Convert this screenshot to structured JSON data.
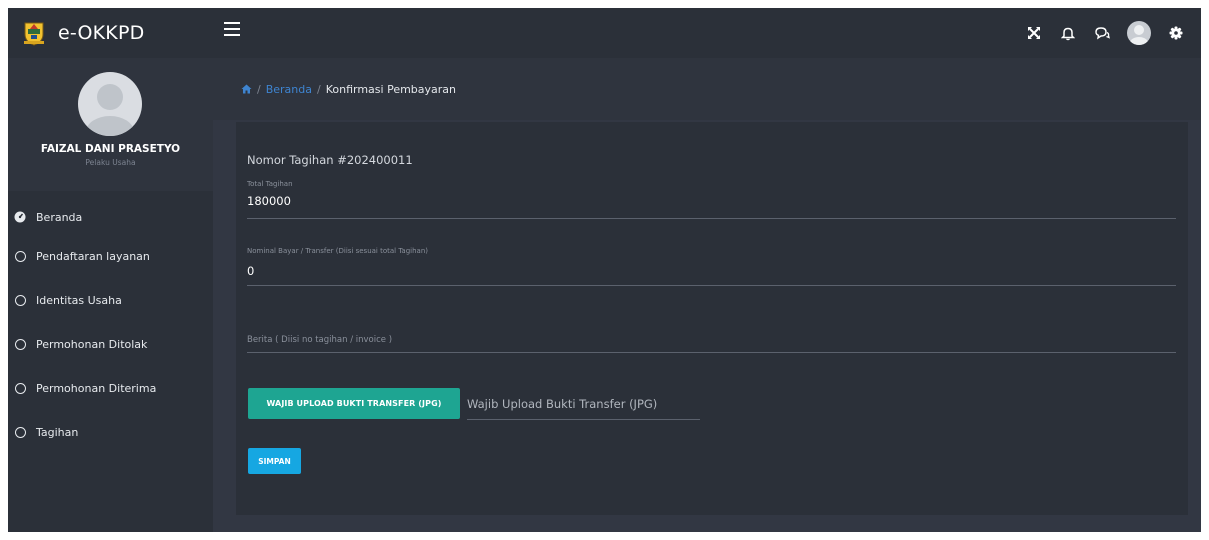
{
  "app": {
    "name": "e-OKKPD",
    "logo_icon": "province-emblem-icon"
  },
  "topbar": {
    "menu_icon": "hamburger-icon",
    "icons": [
      "fullscreen-icon",
      "bell-icon",
      "chat-icon",
      "user-avatar",
      "gear-icon"
    ]
  },
  "user": {
    "name": "FAIZAL DANI PRASETYO",
    "role": "Pelaku Usaha"
  },
  "sidebar": {
    "items": [
      {
        "label": "Beranda",
        "icon": "dashboard-icon"
      },
      {
        "label": "Pendaftaran layanan",
        "icon": "circle-icon"
      },
      {
        "label": "Identitas Usaha",
        "icon": "circle-icon"
      },
      {
        "label": "Permohonan Ditolak",
        "icon": "circle-icon"
      },
      {
        "label": "Permohonan Diterima",
        "icon": "circle-icon"
      },
      {
        "label": "Tagihan",
        "icon": "circle-icon"
      }
    ]
  },
  "breadcrumb": {
    "sep": "/",
    "link": "Beranda",
    "current": "Konfirmasi Pembayaran"
  },
  "form": {
    "invoice_title": "Nomor Tagihan #202400011",
    "total_label": "Total Tagihan",
    "total_value": "180000",
    "nominal_label": "Nominal Bayar / Transfer (Diisi sesuai total Tagihan)",
    "nominal_value": "0",
    "berita_placeholder": "Berita ( Diisi no tagihan / invoice )",
    "upload_button": "WAJIB UPLOAD BUKTI TRANSFER (JPG)",
    "upload_placeholder": "Wajib Upload Bukti Transfer (JPG)",
    "save_button": "SIMPAN"
  },
  "colors": {
    "background": "#323743",
    "panel": "#2b3039",
    "link": "#3e84d0",
    "upload_button": "#1ea592",
    "save_button": "#16a7e2"
  }
}
